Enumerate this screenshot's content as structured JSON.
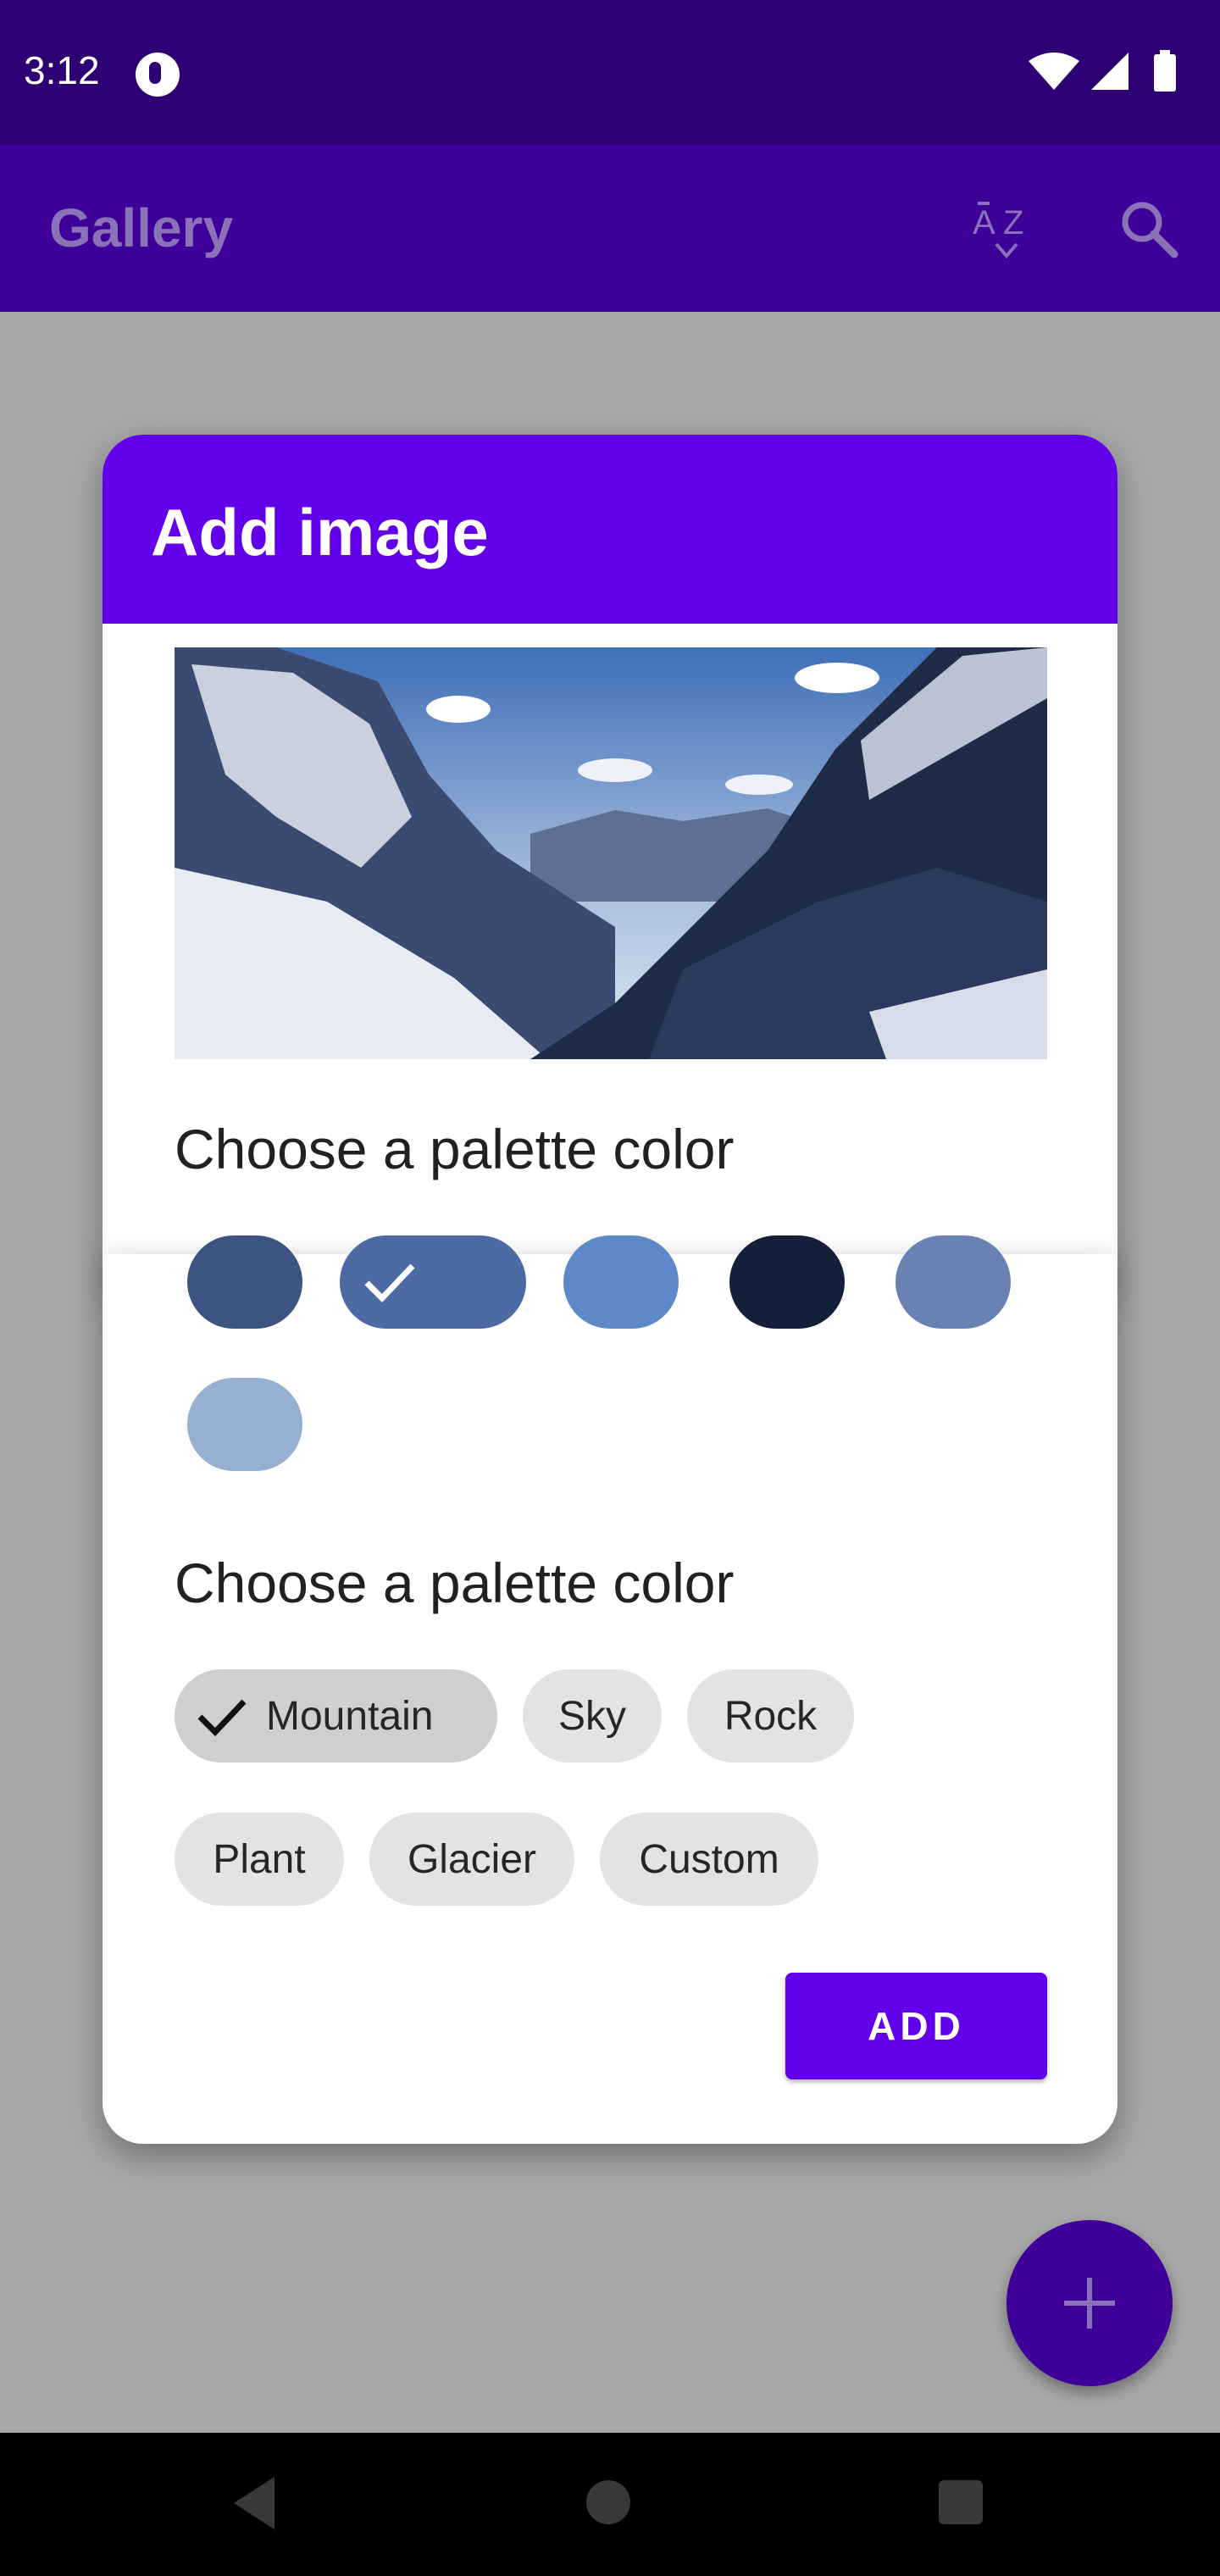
{
  "status_bar": {
    "time": "3:12"
  },
  "app_bar": {
    "title": "Gallery",
    "sort_icon": "sort-az-icon",
    "search_icon": "search-icon"
  },
  "dialog": {
    "title": "Add image",
    "image_description": "snowy-mountain-valley-image",
    "palette_color_label": "Choose a palette color",
    "color_swatches": [
      {
        "color": "#3d5381",
        "selected": false
      },
      {
        "color": "#4c6aa3",
        "selected": true
      },
      {
        "color": "#5d89c9",
        "selected": false
      },
      {
        "color": "#14203a",
        "selected": false
      },
      {
        "color": "#6a82b3",
        "selected": false
      },
      {
        "color": "#97b0d2",
        "selected": false
      }
    ],
    "palette_chip_label": "Choose a palette color",
    "chips": [
      {
        "label": "Mountain",
        "selected": true
      },
      {
        "label": "Sky",
        "selected": false
      },
      {
        "label": "Rock",
        "selected": false
      },
      {
        "label": "Plant",
        "selected": false
      },
      {
        "label": "Glacier",
        "selected": false
      },
      {
        "label": "Custom",
        "selected": false
      }
    ],
    "add_button_label": "ADD"
  },
  "fab": {
    "icon": "plus-icon"
  },
  "nav_bar": {
    "back_icon": "back-triangle-icon",
    "home_icon": "home-circle-icon",
    "recents_icon": "recents-square-icon"
  },
  "colors": {
    "status_bar": "#2d0073",
    "app_bar": "#3e0098",
    "dialog_header": "#6200ea",
    "accent": "#6200ea",
    "scrim_background": "#a8a8a8"
  }
}
